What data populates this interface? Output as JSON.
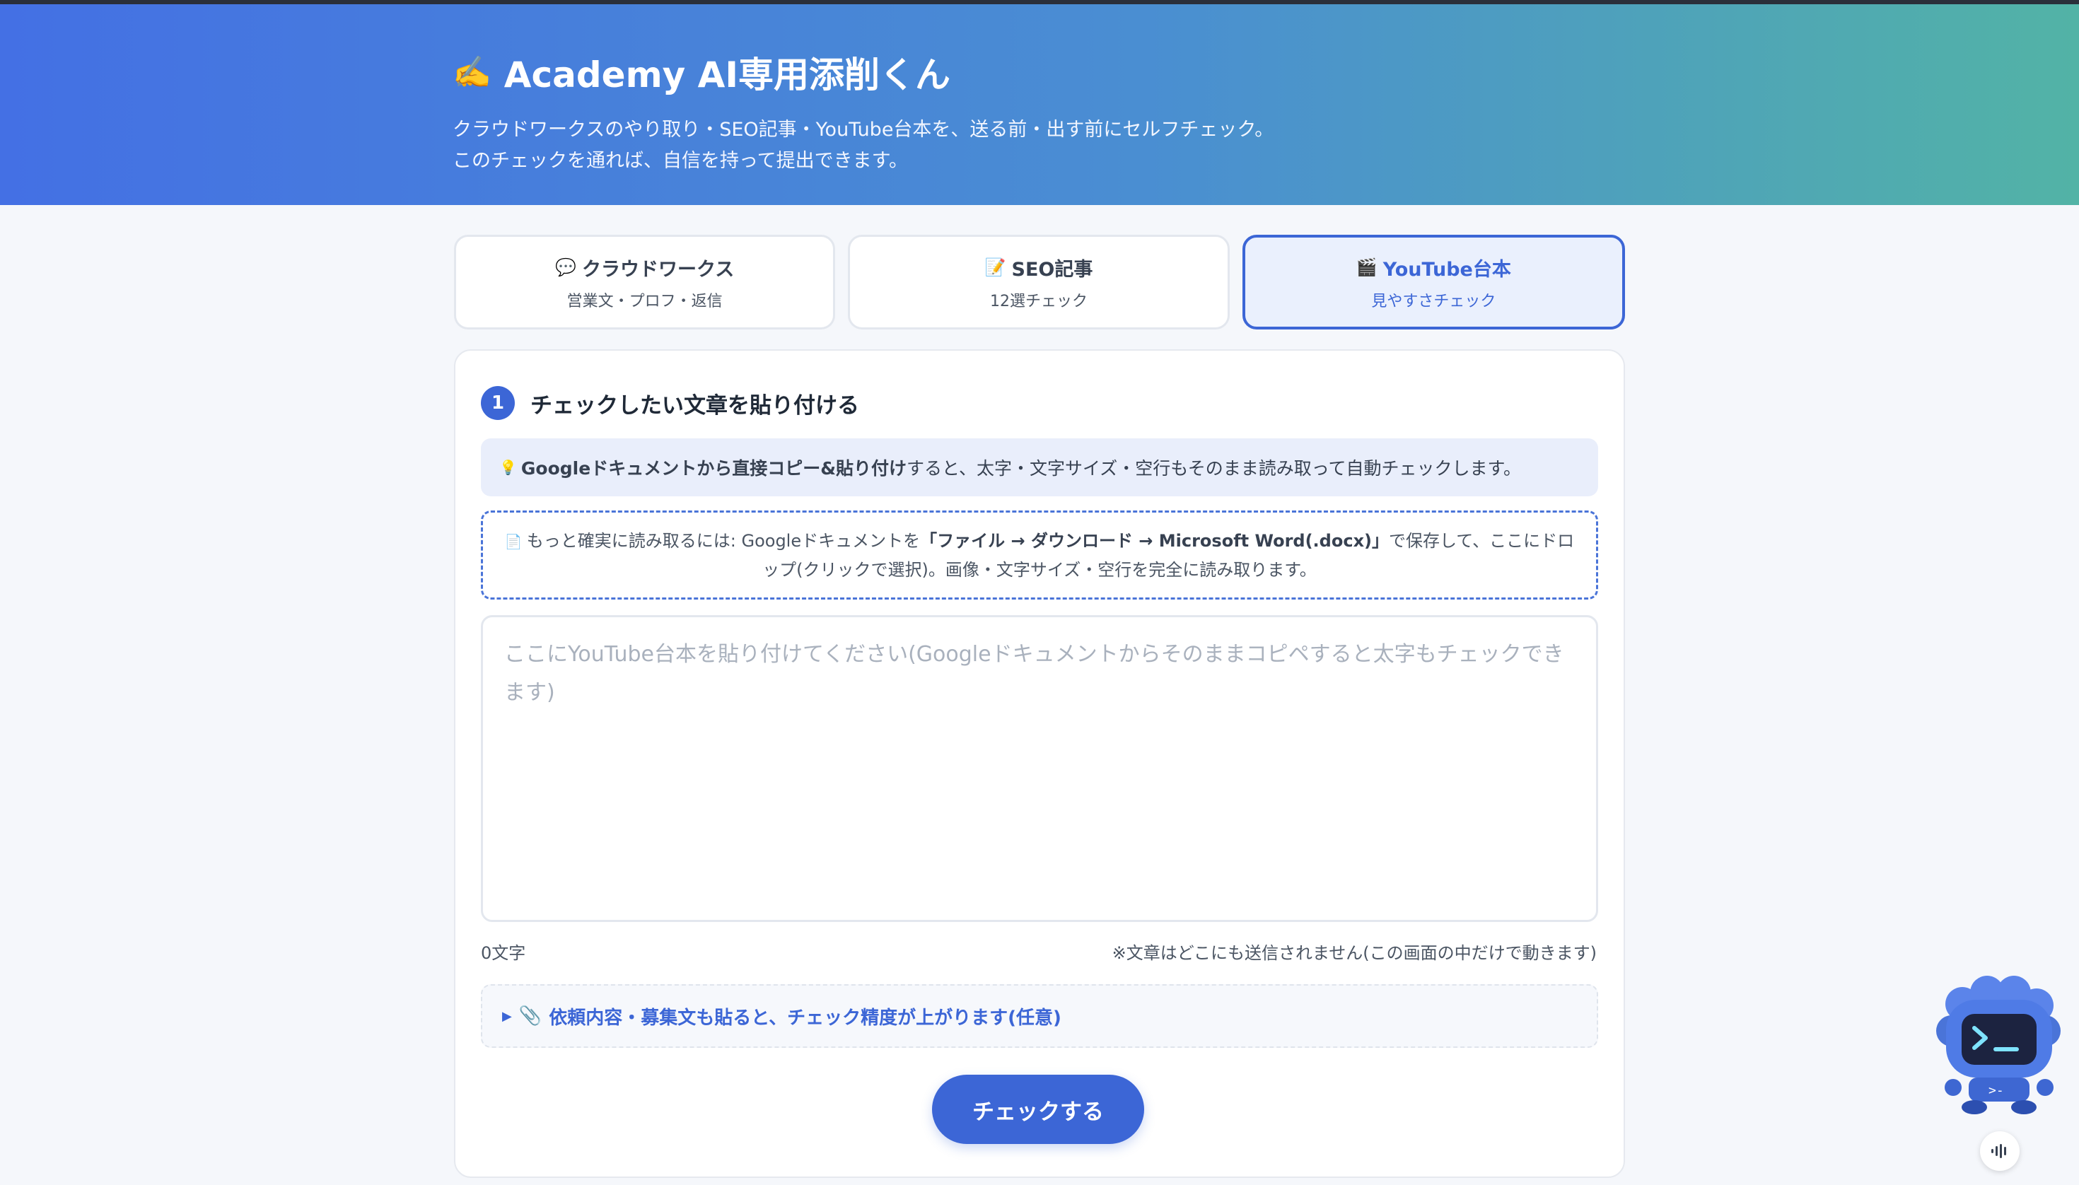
{
  "header": {
    "pen_icon": "✍️",
    "title": "Academy AI専用添削くん",
    "subtitle_line1": "クラウドワークスのやり取り・SEO記事・YouTube台本を、送る前・出す前にセルフチェック。",
    "subtitle_line2": "このチェックを通れば、自信を持って提出できます。"
  },
  "tabs": [
    {
      "icon": "💬",
      "label": "クラウドワークス",
      "sub": "営業文・プロフ・返信",
      "active": false
    },
    {
      "icon": "📝",
      "label": "SEO記事",
      "sub": "12選チェック",
      "active": false
    },
    {
      "icon": "🎬",
      "label": "YouTube台本",
      "sub": "見やすさチェック",
      "active": true
    }
  ],
  "step": {
    "number": "1",
    "title": "チェックしたい文章を貼り付ける"
  },
  "tip": {
    "icon": "💡",
    "bold": "Googleドキュメントから直接コピー&貼り付け",
    "rest": "すると、太字・文字サイズ・空行もそのまま読み取って自動チェックします。"
  },
  "dropzone": {
    "icon": "📄",
    "line1_pre": "もっと確実に読み取るには: Googleドキュメントを",
    "line1_bold": "「ファイル → ダウンロード → Microsoft Word(.docx)」",
    "line1_post": "で保存して、ここにドロ",
    "line2": "ップ(クリックで選択)。画像・文字サイズ・空行を完全に読み取ります。"
  },
  "editor": {
    "placeholder": "ここにYouTube台本を貼り付けてください(Googleドキュメントからそのままコピペすると太字もチェックできます)",
    "value": ""
  },
  "char_count": "0文字",
  "privacy_note": "※文章はどこにも送信されません(この画面の中だけで動きます)",
  "details": {
    "arrow": "▶",
    "icon": "📎",
    "label": "依頼内容・募集文も貼ると、チェック精度が上がります(任意)"
  },
  "check_button": "チェックする",
  "colors": {
    "accent": "#3c66d6",
    "header_gradient_start": "#4470e4",
    "header_gradient_end": "#52b3a6",
    "background": "#f5f7fb"
  }
}
